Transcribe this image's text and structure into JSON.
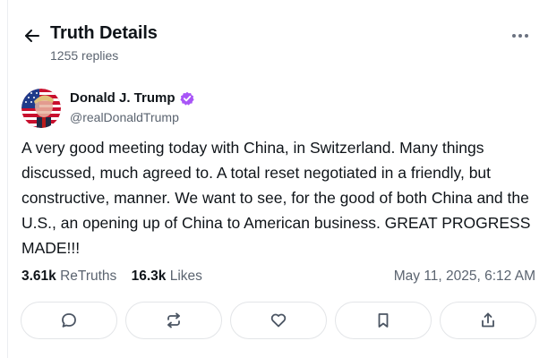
{
  "header": {
    "title": "Truth Details",
    "replies": "1255 replies",
    "back_icon": "arrow-left-icon",
    "more_icon": "more-horizontal-icon"
  },
  "author": {
    "name": "Donald J. Trump",
    "handle": "@realDonaldTrump",
    "verified_color": "#a855f7"
  },
  "post": {
    "text": "A very good meeting today with China, in Switzerland. Many things discussed, much agreed to. A total reset negotiated in a friendly, but constructive, manner. We want to see, for the good of both China and the U.S., an opening up of China to American business. GREAT PROGRESS MADE!!!"
  },
  "stats": {
    "retruths_count": "3.61k",
    "retruths_label": "ReTruths",
    "likes_count": "16.3k",
    "likes_label": "Likes",
    "timestamp": "May 11, 2025, 6:12 AM"
  },
  "actions": [
    {
      "name": "reply",
      "icon": "comment-icon"
    },
    {
      "name": "retruth",
      "icon": "repost-icon"
    },
    {
      "name": "like",
      "icon": "heart-icon"
    },
    {
      "name": "bookmark",
      "icon": "bookmark-icon"
    },
    {
      "name": "share",
      "icon": "share-icon"
    }
  ],
  "colors": {
    "text_primary": "#0f1419",
    "text_secondary": "#5b6470",
    "border": "#e3e5e8",
    "icon": "#4b5563"
  }
}
